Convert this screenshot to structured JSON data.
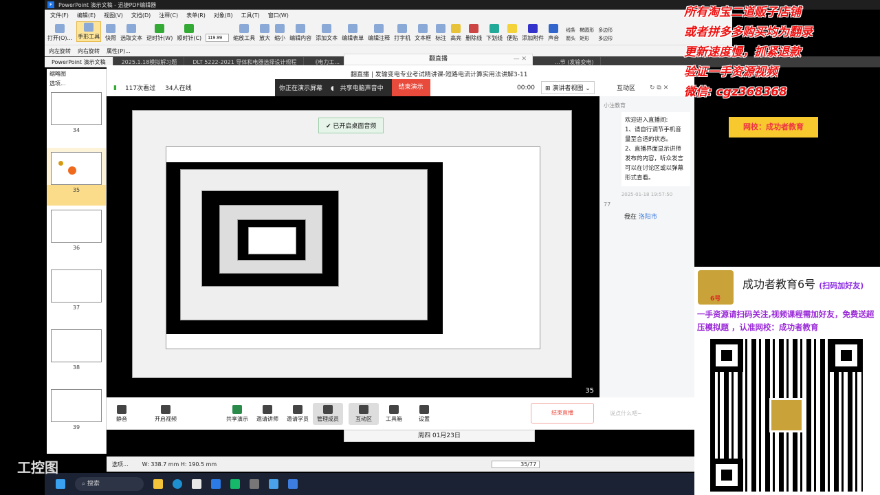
{
  "app": {
    "title": "PowerPoint 演示文稿 - 迅捷PDF编辑器",
    "logo": "F"
  },
  "menu": [
    "文件(F)",
    "编辑(E)",
    "视图(V)",
    "文档(D)",
    "注释(C)",
    "表单(R)",
    "对象(B)",
    "工具(T)",
    "窗口(W)"
  ],
  "toolbar": {
    "items": [
      "打开(O)...",
      "手形工具",
      "快照",
      "选取文本",
      "逆时针(W)",
      "顺时针(C)",
      "缩放工具",
      "放大",
      "缩小",
      "编辑内容",
      "添加文本",
      "编辑表单",
      "编辑注释",
      "打字机",
      "文本框",
      "标注",
      "高亮",
      "删除线",
      "下划线",
      "便贴",
      "添加附件",
      "声音"
    ],
    "zoom": "119.99",
    "shapes": [
      "线条",
      "椭圆形",
      "多边形",
      "箭头",
      "矩形",
      "多边形"
    ]
  },
  "toolbar2": [
    "向左旋转",
    "向右旋转",
    "属性(P)..."
  ],
  "tabs": [
    "PowerPoint 演示文稿",
    "2025.1.18模拟解习题",
    "DLT 5222-2021 导体和电器选择设计规程",
    "《电力工...",
    "...节 (发输变电)"
  ],
  "thumbs": {
    "title": "缩略图",
    "options": "选项...",
    "pages": [
      "34",
      "35",
      "36",
      "37",
      "38",
      "39"
    ],
    "selected": "35"
  },
  "live": {
    "window_title": "翻直播",
    "course": "翻直播 | 发输变电专业考试精讲课-短路电流计算实用法讲解3-11",
    "views": "117次看过",
    "online": "34人在线",
    "presenting": "你正在演示屏幕",
    "audio": "共享电脑声音中",
    "stop": "结束演示",
    "timer": "00:00",
    "view_mode": "演讲者视图",
    "toast": "已开启桌面音频",
    "page_number": "35"
  },
  "side": {
    "title": "互动区",
    "manage": "管理成员",
    "sender": "小注教育",
    "message": [
      "欢迎进入直播间:",
      "1、请自行调节手机音量至合适的状态。",
      "2、直播界面显示讲师发布的内容，听众发言可以在讨论区或以弹幕形式查看。"
    ],
    "timestamp": "2025-01-18 19:57:50",
    "user": "77",
    "location_prefix": "我在",
    "location": "洛阳市"
  },
  "bottombar": {
    "items": [
      "静音",
      "开启视频",
      "共享演示",
      "邀请讲师",
      "邀请学员",
      "管理成员",
      "互动区",
      "工具箱",
      "设置"
    ],
    "end": "结束直播",
    "input_placeholder": "说点什么吧~"
  },
  "date_popup": "周四 01月23日",
  "statusbar": {
    "page": "35/77",
    "size": "W: 338.7 mm H: 190.5 mm",
    "left": "选项..."
  },
  "taskbar": {
    "search": "搜索"
  },
  "overlay": {
    "lines": [
      "所有淘宝二道贩子店铺",
      "或者拼多多购买均为翻录",
      "更新速度慢，抓紧退款",
      "验证一手资源视频",
      "微信: cgz368368"
    ],
    "badge": "网校：成功者教育",
    "card_title": "成功者教育6号",
    "card_sub": "(扫码加好友)",
    "card_text": "一手资源请扫码关注,视频课程需加好友，免费送超压模拟题 ，认准网校：成功者教育",
    "avatar_text": "6号"
  },
  "watermark": "工控图"
}
